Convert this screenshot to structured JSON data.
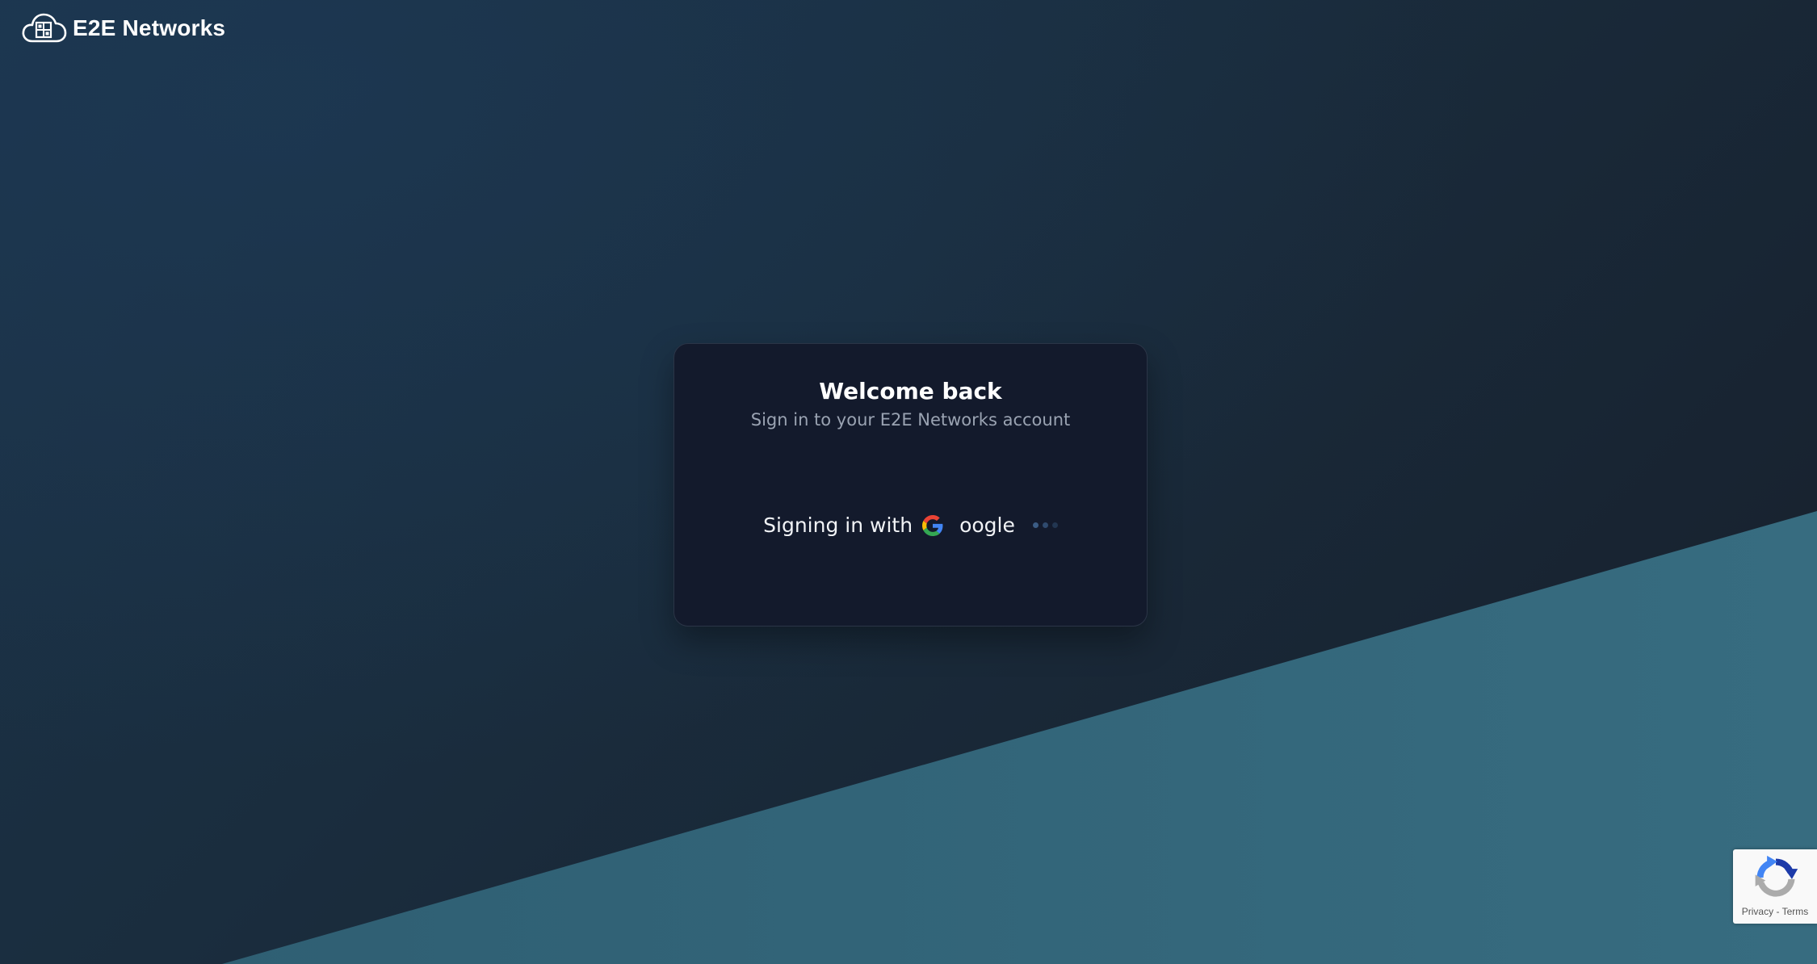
{
  "header": {
    "brand_name": "E2E Networks",
    "logo_icon": "cloud-logo-icon"
  },
  "card": {
    "title": "Welcome back",
    "subtitle": "Sign in to your E2E Networks account",
    "signin_prefix": "Signing in with",
    "provider_icon": "google-g-icon",
    "provider_suffix": "oogle"
  },
  "recaptcha": {
    "icon": "recaptcha-icon",
    "privacy_link": "Privacy",
    "separator": "-",
    "terms_link": "Terms"
  },
  "colors": {
    "background_dark": "#1a2d3e",
    "wedge_teal": "#356a7e",
    "card_background": "#131a2c",
    "subtitle_text": "#9aa3b2"
  }
}
